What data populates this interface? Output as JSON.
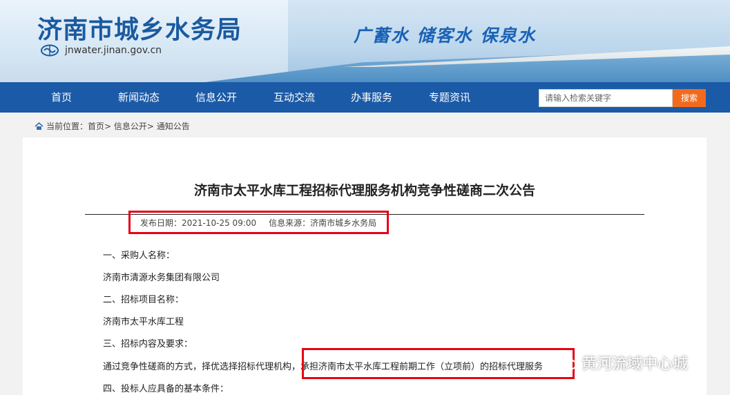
{
  "header": {
    "site_title": "济南市城乡水务局",
    "domain": "jnwater.jinan.gov.cn",
    "slogan": "广蓄水  储客水  保泉水"
  },
  "nav": {
    "items": [
      "首页",
      "新闻动态",
      "信息公开",
      "互动交流",
      "办事服务",
      "专题资讯"
    ],
    "search_placeholder": "请输入检索关键字",
    "search_button": "搜索"
  },
  "breadcrumb": "当前位置：首页> 信息公开> 通知公告",
  "article": {
    "title": "济南市太平水库工程招标代理服务机构竞争性磋商二次公告",
    "publish_date": "发布日期：2021-10-25 09:00",
    "source": "信息来源：济南市城乡水务局",
    "paragraphs": [
      "一、采购人名称：",
      "济南市清源水务集团有限公司",
      "二、招标项目名称：",
      "济南市太平水库工程",
      "三、招标内容及要求：",
      "通过竞争性磋商的方式，择优选择招标代理机构，承担济南市太平水库工程前期工作（立项前）的招标代理服务",
      "四、投标人应具备的基本条件："
    ]
  },
  "watermark": "黄河流域中心城",
  "colors": {
    "nav": "#1b5aa6",
    "search_button": "#f26b1d",
    "highlight": "#e60012"
  }
}
